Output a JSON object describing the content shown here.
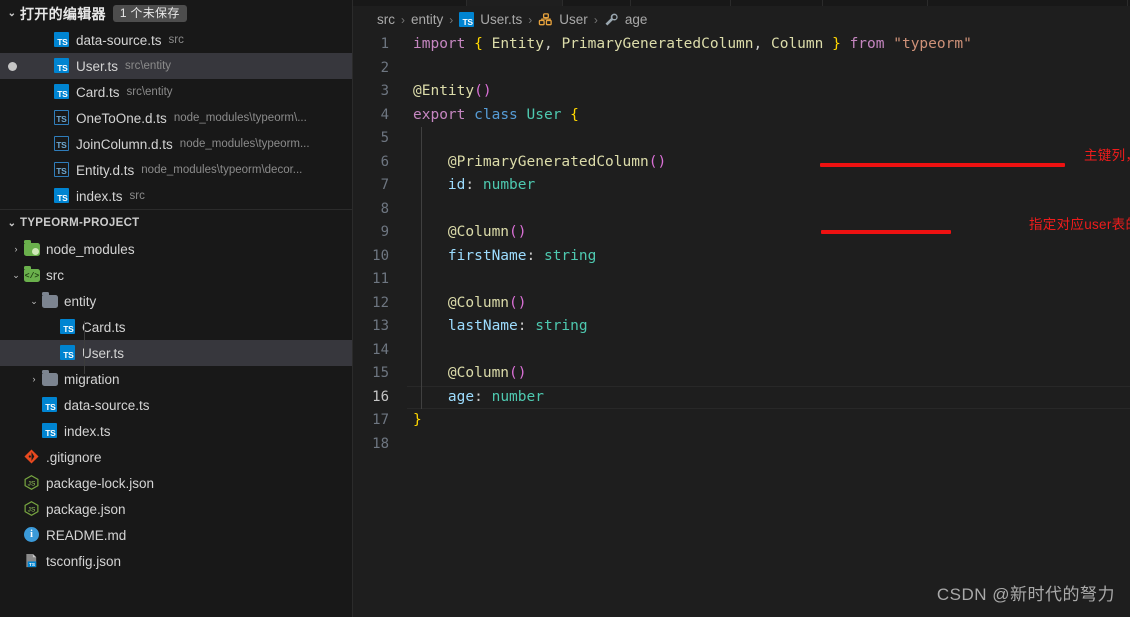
{
  "sidebar": {
    "open_editors": {
      "title": "打开的编辑器",
      "badge": "1 个未保存",
      "twisty": "⌄",
      "items": [
        {
          "name": "data-source.ts",
          "desc": "src",
          "icon": "ts-file-icon",
          "dirty": false,
          "selected": false
        },
        {
          "name": "User.ts",
          "desc": "src\\entity",
          "icon": "ts-file-icon",
          "dirty": true,
          "selected": true
        },
        {
          "name": "Card.ts",
          "desc": "src\\entity",
          "icon": "ts-file-icon",
          "dirty": false,
          "selected": false
        },
        {
          "name": "OneToOne.d.ts",
          "desc": "node_modules\\typeorm\\...",
          "icon": "ts-declaration-icon",
          "dirty": false,
          "selected": false
        },
        {
          "name": "JoinColumn.d.ts",
          "desc": "node_modules\\typeorm...",
          "icon": "ts-declaration-icon",
          "dirty": false,
          "selected": false
        },
        {
          "name": "Entity.d.ts",
          "desc": "node_modules\\typeorm\\decor...",
          "icon": "ts-declaration-icon",
          "dirty": false,
          "selected": false
        },
        {
          "name": "index.ts",
          "desc": "src",
          "icon": "ts-file-icon",
          "dirty": false,
          "selected": false
        }
      ]
    },
    "explorer": {
      "title": "TYPEORM-PROJECT",
      "twisty": "⌄",
      "items": [
        {
          "name": "node_modules",
          "kind": "folder",
          "icon": "folder-node-modules-icon",
          "depth": 1,
          "expanded": false,
          "chevron": "›",
          "selected": false
        },
        {
          "name": "src",
          "kind": "folder",
          "icon": "folder-src-icon",
          "depth": 1,
          "expanded": true,
          "chevron": "⌄",
          "selected": false
        },
        {
          "name": "entity",
          "kind": "folder",
          "icon": "folder-icon",
          "depth": 2,
          "expanded": true,
          "chevron": "⌄",
          "selected": false
        },
        {
          "name": "Card.ts",
          "kind": "file",
          "icon": "ts-file-icon",
          "depth": 3,
          "expanded": false,
          "chevron": "",
          "selected": false
        },
        {
          "name": "User.ts",
          "kind": "file",
          "icon": "ts-file-icon",
          "depth": 3,
          "expanded": false,
          "chevron": "",
          "selected": true
        },
        {
          "name": "migration",
          "kind": "folder",
          "icon": "folder-icon",
          "depth": 2,
          "expanded": false,
          "chevron": "›",
          "selected": false
        },
        {
          "name": "data-source.ts",
          "kind": "file",
          "icon": "ts-file-icon",
          "depth": 2,
          "expanded": false,
          "chevron": "",
          "selected": false
        },
        {
          "name": "index.ts",
          "kind": "file",
          "icon": "ts-file-icon",
          "depth": 2,
          "expanded": false,
          "chevron": "",
          "selected": false
        },
        {
          "name": ".gitignore",
          "kind": "file",
          "icon": "git-icon",
          "depth": 1,
          "expanded": false,
          "chevron": "",
          "selected": false
        },
        {
          "name": "package-lock.json",
          "kind": "file",
          "icon": "nodejs-icon",
          "depth": 1,
          "expanded": false,
          "chevron": "",
          "selected": false
        },
        {
          "name": "package.json",
          "kind": "file",
          "icon": "nodejs-icon",
          "depth": 1,
          "expanded": false,
          "chevron": "",
          "selected": false
        },
        {
          "name": "README.md",
          "kind": "file",
          "icon": "info-icon",
          "depth": 1,
          "expanded": false,
          "chevron": "",
          "selected": false
        },
        {
          "name": "tsconfig.json",
          "kind": "file",
          "icon": "tsconfig-icon",
          "depth": 1,
          "expanded": false,
          "chevron": "",
          "selected": false
        }
      ]
    }
  },
  "breadcrumb": [
    {
      "label": "src",
      "icon": ""
    },
    {
      "label": "entity",
      "icon": ""
    },
    {
      "label": "User.ts",
      "icon": "ts-file-icon"
    },
    {
      "label": "User",
      "icon": "symbol-class-icon"
    },
    {
      "label": "age",
      "icon": "symbol-property-icon"
    }
  ],
  "breadcrumb_separator": "›",
  "editor": {
    "active_line": 16,
    "lines": [
      {
        "n": "1",
        "text": "import { Entity, PrimaryGeneratedColumn, Column } from \"typeorm\""
      },
      {
        "n": "2",
        "text": ""
      },
      {
        "n": "3",
        "text": "@Entity()"
      },
      {
        "n": "4",
        "text": "export class User {"
      },
      {
        "n": "5",
        "text": ""
      },
      {
        "n": "6",
        "text": "    @PrimaryGeneratedColumn()"
      },
      {
        "n": "7",
        "text": "    id: number"
      },
      {
        "n": "8",
        "text": ""
      },
      {
        "n": "9",
        "text": "    @Column()"
      },
      {
        "n": "10",
        "text": "    firstName: string"
      },
      {
        "n": "11",
        "text": ""
      },
      {
        "n": "12",
        "text": "    @Column()"
      },
      {
        "n": "13",
        "text": "    lastName: string"
      },
      {
        "n": "14",
        "text": ""
      },
      {
        "n": "15",
        "text": "    @Column()"
      },
      {
        "n": "16",
        "text": "    age: number"
      },
      {
        "n": "17",
        "text": "}"
      },
      {
        "n": "18",
        "text": ""
      }
    ]
  },
  "annotations": [
    {
      "text": "主键列，自增",
      "color": "#ee1c1c"
    },
    {
      "text": "指定对应user表的列",
      "color": "#ee1c1c"
    }
  ],
  "watermark": "CSDN @新时代的弩力",
  "colors": {
    "sidebar_bg": "#181818",
    "editor_bg": "#1e1e1e",
    "selection_bg": "#37373d",
    "annotation_red": "#ee1c1c",
    "ts_blue": "#0084d1",
    "accent_green": "#6ab04c"
  }
}
